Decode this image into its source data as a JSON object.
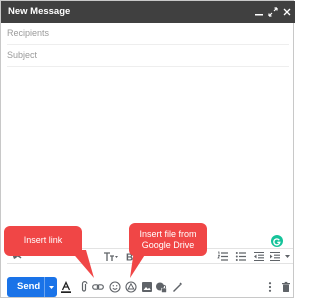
{
  "window": {
    "title": "New Message"
  },
  "fields": {
    "recipients": "Recipients",
    "subject": "Subject"
  },
  "compose": {
    "send_label": "Send"
  },
  "annotations": {
    "insert_link": "Insert link",
    "insert_drive_line1": "Insert file from",
    "insert_drive_line2": "Google Drive"
  },
  "colors": {
    "titlebar": "#404040",
    "send_button": "#1a73e8",
    "callout": "#f04646",
    "grammarly": "#15c39a",
    "icon_gray": "#5f6368"
  },
  "icons": {
    "titlebar": [
      "minimize-icon",
      "expand-icon",
      "close-icon"
    ],
    "formatting": [
      "undo-icon",
      "font-size-icon",
      "bold-icon",
      "numbered-list-icon",
      "bulleted-list-icon",
      "indent-less-icon",
      "indent-more-icon",
      "more-formatting-icon"
    ],
    "bottom": [
      "formatting-options-icon",
      "attach-icon",
      "link-icon",
      "emoji-icon",
      "drive-icon",
      "photo-icon",
      "confidential-icon",
      "signature-icon",
      "more-options-icon",
      "delete-icon"
    ]
  }
}
